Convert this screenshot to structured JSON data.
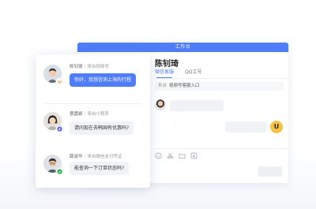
{
  "workbench": {
    "title": "工作台",
    "contact_name": "陈钊琦",
    "tabs": [
      {
        "label": "微信客服",
        "active": true
      },
      {
        "label": "QQ工号",
        "active": false
      }
    ],
    "source": {
      "label": "来自",
      "value": "视频号客服入口"
    },
    "agent_badge": "U"
  },
  "conversations": [
    {
      "name": "陈钊琦",
      "source": "来自视频号",
      "message": "你好，我想咨询上海的行程",
      "highlighted": true,
      "channel_icon": "video-channel-icon"
    },
    {
      "name": "曹嘉颖",
      "source": "来自小程序",
      "message": "请问现在去韩国有优惠吗?",
      "highlighted": false,
      "channel_icon": "mini-program-icon"
    },
    {
      "name": "薛淑华",
      "source": "来自微信支付凭证",
      "message": "能查询一下订单状态吗?",
      "highlighted": false,
      "channel_icon": "wechat-pay-icon"
    }
  ],
  "colors": {
    "accent": "#4f7cf7",
    "badge_yellow": "#f6c342",
    "pay_green": "#2bb24c",
    "video_orange": "#f7a63b"
  }
}
